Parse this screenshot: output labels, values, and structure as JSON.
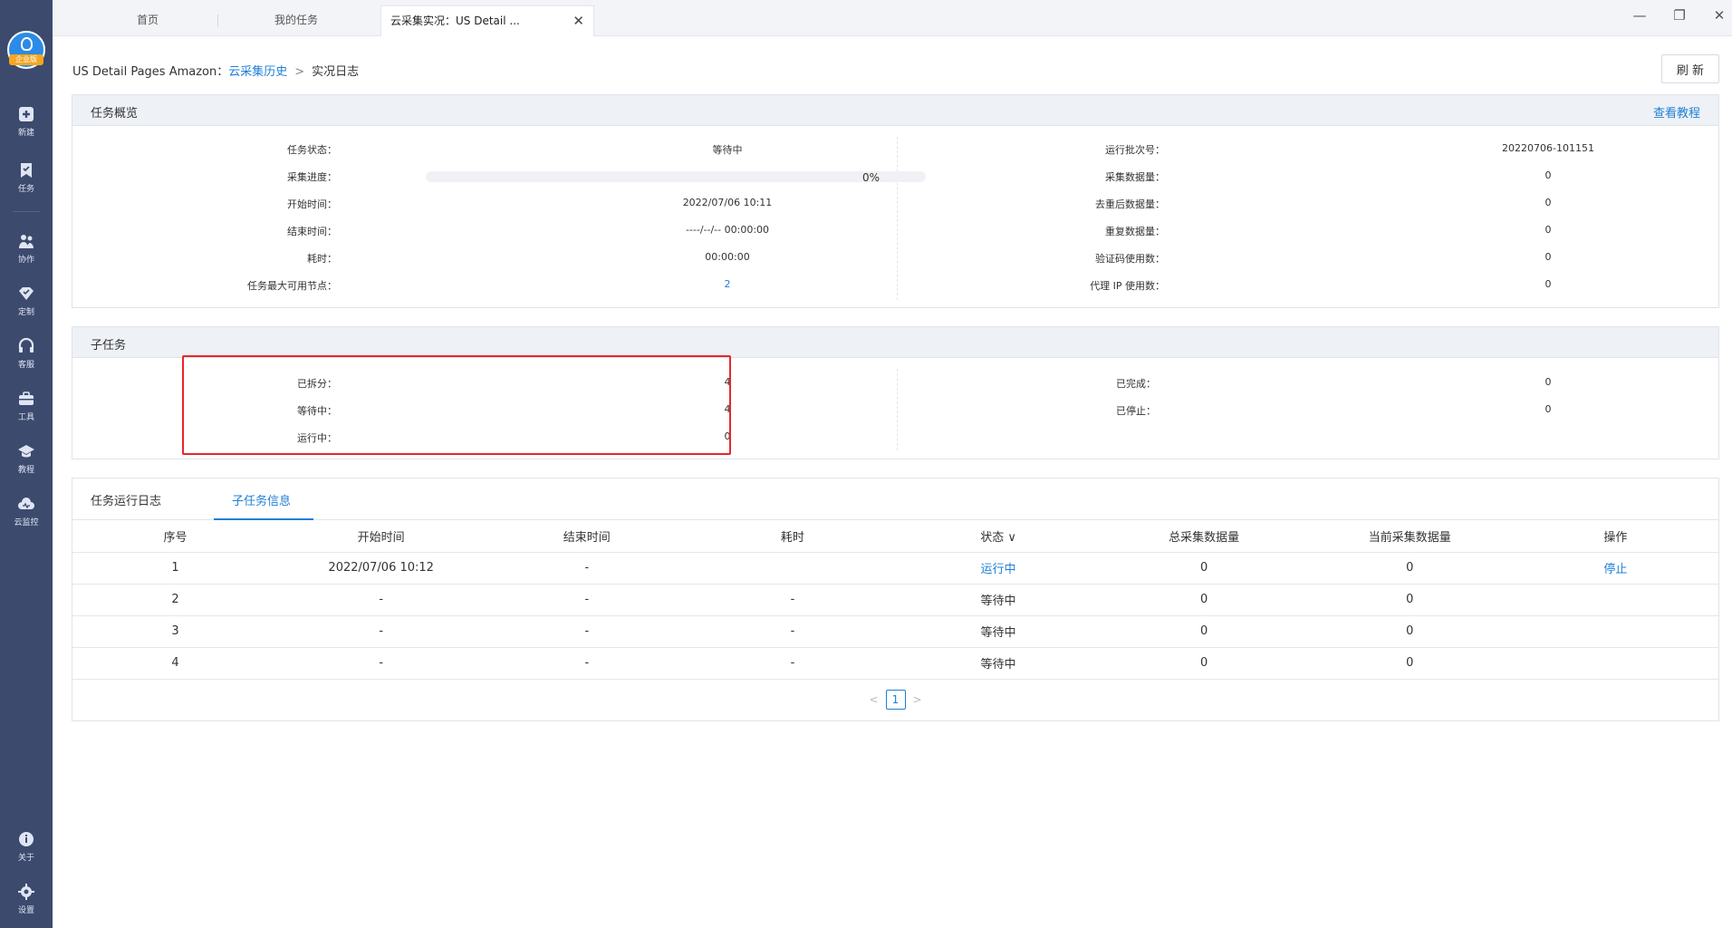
{
  "sidebar": {
    "badge": "企业版",
    "items": [
      {
        "label": "新建",
        "icon": "plus-icon"
      },
      {
        "label": "任务",
        "icon": "bookmark-icon"
      },
      {
        "label": "协作",
        "icon": "people-icon"
      },
      {
        "label": "定制",
        "icon": "diamond-icon"
      },
      {
        "label": "客服",
        "icon": "headset-icon"
      },
      {
        "label": "工具",
        "icon": "toolbox-icon"
      },
      {
        "label": "教程",
        "icon": "graduation-cap-icon"
      },
      {
        "label": "云监控",
        "icon": "cloud-monitor-icon"
      },
      {
        "label": "关于",
        "icon": "info-icon"
      },
      {
        "label": "设置",
        "icon": "gear-icon"
      }
    ]
  },
  "tabs": [
    {
      "label": "首页"
    },
    {
      "label": "我的任务"
    },
    {
      "label": "云采集实况：US Detail ..."
    }
  ],
  "breadcrumb": {
    "root": "US Detail Pages Amazon：",
    "link": "云采集历史",
    "separator": ">",
    "current": "实况日志"
  },
  "refresh_label": "刷 新",
  "overview": {
    "title": "任务概览",
    "tutorial_link": "查看教程",
    "left": [
      {
        "label": "任务状态：",
        "value": "等待中"
      },
      {
        "label": "采集进度：",
        "value": "0%"
      },
      {
        "label": "开始时间：",
        "value": "2022/07/06 10:11"
      },
      {
        "label": "结束时间：",
        "value": "----/--/-- 00:00:00"
      },
      {
        "label": "耗时：",
        "value": "00:00:00"
      },
      {
        "label": "任务最大可用节点：",
        "value": "2"
      }
    ],
    "right": [
      {
        "label": "运行批次号：",
        "value": "20220706-101151"
      },
      {
        "label": "采集数据量：",
        "value": "0"
      },
      {
        "label": "去重后数据量：",
        "value": "0"
      },
      {
        "label": "重复数据量：",
        "value": "0"
      },
      {
        "label": "验证码使用数：",
        "value": "0"
      },
      {
        "label": "代理 IP 使用数：",
        "value": "0"
      }
    ],
    "progress_fraction": 0
  },
  "subtasks": {
    "title": "子任务",
    "left": [
      {
        "label": "已拆分：",
        "value": "4"
      },
      {
        "label": "等待中：",
        "value": "4"
      },
      {
        "label": "运行中：",
        "value": "0"
      }
    ],
    "right": [
      {
        "label": "已完成：",
        "value": "0"
      },
      {
        "label": "已停止：",
        "value": "0"
      }
    ]
  },
  "log": {
    "tabs": [
      "任务运行日志",
      "子任务信息"
    ],
    "active_tab": 1,
    "columns": [
      "序号",
      "开始时间",
      "结束时间",
      "耗时",
      "状态",
      "总采集数据量",
      "当前采集数据量",
      "操作"
    ],
    "status_dropdown_icon": "chevron-down-icon",
    "rows": [
      [
        "1",
        "2022/07/06 10:12",
        "-",
        "",
        "运行中",
        "0",
        "0",
        "停止"
      ],
      [
        "2",
        "-",
        "-",
        "-",
        "等待中",
        "0",
        "0",
        ""
      ],
      [
        "3",
        "-",
        "-",
        "-",
        "等待中",
        "0",
        "0",
        ""
      ],
      [
        "4",
        "-",
        "-",
        "-",
        "等待中",
        "0",
        "0",
        ""
      ]
    ],
    "page": "1"
  },
  "colors": {
    "accent": "#1f7fd6",
    "sidebar": "#3c4a6e",
    "highlight": "#e8262b"
  }
}
